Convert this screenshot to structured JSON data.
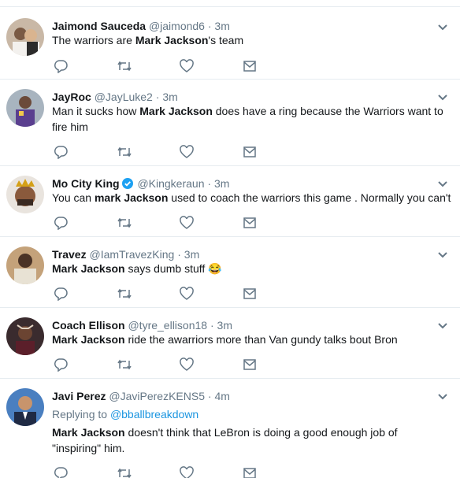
{
  "tweets": [
    {
      "name": "Jaimond Sauceda",
      "handle": "@jaimond6",
      "sep": "·",
      "time": "3m",
      "verified": false,
      "text_parts": [
        {
          "t": "The warriors are ",
          "b": false
        },
        {
          "t": "Mark Jackson",
          "b": true
        },
        {
          "t": "'s team",
          "b": false
        }
      ]
    },
    {
      "name": "JayRoc",
      "handle": "@JayLuke2",
      "sep": "·",
      "time": "3m",
      "verified": false,
      "text_parts": [
        {
          "t": "Man it sucks how ",
          "b": false
        },
        {
          "t": "Mark Jackson",
          "b": true
        },
        {
          "t": " does have a ring because the Warriors want to fire him",
          "b": false
        }
      ]
    },
    {
      "name": "Mo City King",
      "handle": "@Kingkeraun",
      "sep": "·",
      "time": "3m",
      "verified": true,
      "text_parts": [
        {
          "t": "You can ",
          "b": false
        },
        {
          "t": "mark Jackson",
          "b": true
        },
        {
          "t": " used to coach the warriors this game . Normally you can't",
          "b": false
        }
      ]
    },
    {
      "name": "Travez",
      "handle": "@IamTravezKing",
      "sep": "·",
      "time": "3m",
      "verified": false,
      "text_parts": [
        {
          "t": "Mark Jackson",
          "b": true
        },
        {
          "t": " says dumb stuff ",
          "b": false
        },
        {
          "t": "😂",
          "b": false
        }
      ]
    },
    {
      "name": "Coach Ellison",
      "handle": "@tyre_ellison18",
      "sep": "·",
      "time": "3m",
      "verified": false,
      "text_parts": [
        {
          "t": "Mark Jackson",
          "b": true
        },
        {
          "t": " ride the awarriors more than Van gundy talks bout Bron",
          "b": false
        }
      ]
    },
    {
      "name": "Javi Perez",
      "handle": "@JaviPerezKENS5",
      "sep": "·",
      "time": "4m",
      "verified": false,
      "replying_label": "Replying to",
      "replying_to": "@bballbreakdown",
      "text_parts": [
        {
          "t": "Mark Jackson",
          "b": true
        },
        {
          "t": " doesn't think that LeBron is doing a good enough job of \"inspiring\" him.",
          "b": false
        }
      ]
    }
  ],
  "icons": {
    "reply": "reply-icon",
    "retweet": "retweet-icon",
    "like": "like-icon",
    "message": "message-icon",
    "menu": "chevron-down-icon"
  },
  "colors": {
    "text": "#14171a",
    "muted": "#657786",
    "link": "#1b95e0",
    "verified": "#1da1f2",
    "divider": "#e6ecf0"
  }
}
